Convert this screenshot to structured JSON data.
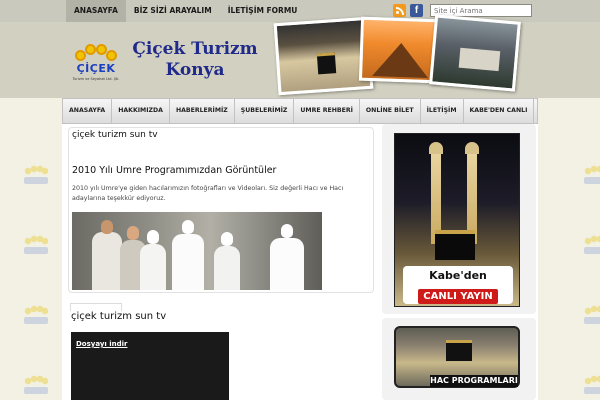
{
  "topnav": {
    "items": [
      "ANASAYFA",
      "BİZ SİZİ ARAYALIM",
      "İLETİŞİM FORMU"
    ],
    "active_index": 0
  },
  "search": {
    "placeholder": "Site içi Arama"
  },
  "social": {
    "rss_icon": "rss-icon",
    "facebook_icon": "facebook-icon",
    "facebook_glyph": "f"
  },
  "header": {
    "logo_text": "ÇİÇEK",
    "logo_sub": "Turizm ve Seyahat Ltd. Şti.",
    "title_line1": "Çiçek Turizm",
    "title_line2": "Konya"
  },
  "mainnav": {
    "items": [
      "ANASAYFA",
      "HAKKIMIZDA",
      "HABERLERİMİZ",
      "ŞUBELERİMİZ",
      "UMRE REHBERİ",
      "ONLİNE BİLET",
      "İLETİŞİM",
      "KABE'DEN CANLI"
    ]
  },
  "post": {
    "title": "çiçek turizm sun tv",
    "heading": "2010 Yılı Umre Programımızdan Görüntüler",
    "excerpt": "2010 yılı Umre'ye giden hacılarımızın fotoğrafları ve Videoları. Siz değerli Hacı ve Hacı adaylarına teşekkür ediyoruz."
  },
  "post2": {
    "title": "çiçek turizm sun tv",
    "download_link": "Dosyayı indir"
  },
  "sidebar": {
    "live_line1": "Kabe'den",
    "live_line2": "CANLI YAYIN",
    "hac_label": "HAC PROGRAMLARI"
  },
  "colors": {
    "brand_blue": "#1f2a8a",
    "live_red": "#cf1a1a",
    "logo_yellow": "#f0c400"
  }
}
